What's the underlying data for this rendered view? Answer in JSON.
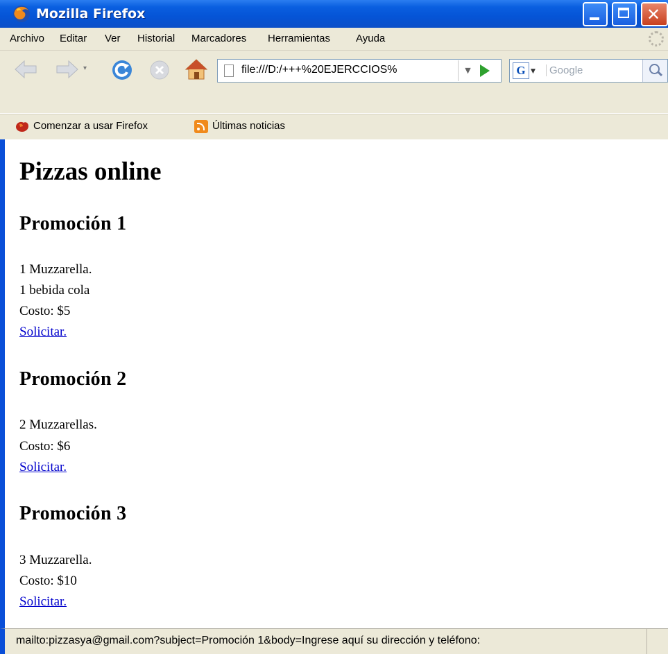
{
  "window": {
    "title": "Mozilla Firefox",
    "controls": {
      "minimize": "minimize-button",
      "maximize": "maximize-button",
      "close": "close-button"
    }
  },
  "menu": {
    "items": [
      "Archivo",
      "Editar",
      "Ver",
      "Historial",
      "Marcadores",
      "Herramientas",
      "Ayuda"
    ]
  },
  "nav": {
    "url": "file:///D:/+++%20EJERCCIOS%",
    "search_placeholder": "Google"
  },
  "bookmarks": {
    "items": [
      "Comenzar a usar Firefox",
      "Últimas noticias"
    ]
  },
  "page": {
    "title": "Pizzas online",
    "promos": [
      {
        "heading": "Promoción 1",
        "lines": [
          "1 Muzzarella.",
          "1 bebida cola",
          "Costo: $5"
        ],
        "link": "Solicitar."
      },
      {
        "heading": "Promoción 2",
        "lines": [
          "2 Muzzarellas.",
          "Costo: $6"
        ],
        "link": "Solicitar."
      },
      {
        "heading": "Promoción 3",
        "lines": [
          "3 Muzzarella.",
          "Costo: $10"
        ],
        "link": "Solicitar."
      }
    ]
  },
  "status": {
    "text": "mailto:pizzasya@gmail.com?subject=Promoción 1&body=Ingrese aquí su dirección y teléfono:"
  },
  "colors": {
    "titlebar": "#0554d6",
    "chrome": "#ece9d8",
    "link": "#0000cc"
  }
}
